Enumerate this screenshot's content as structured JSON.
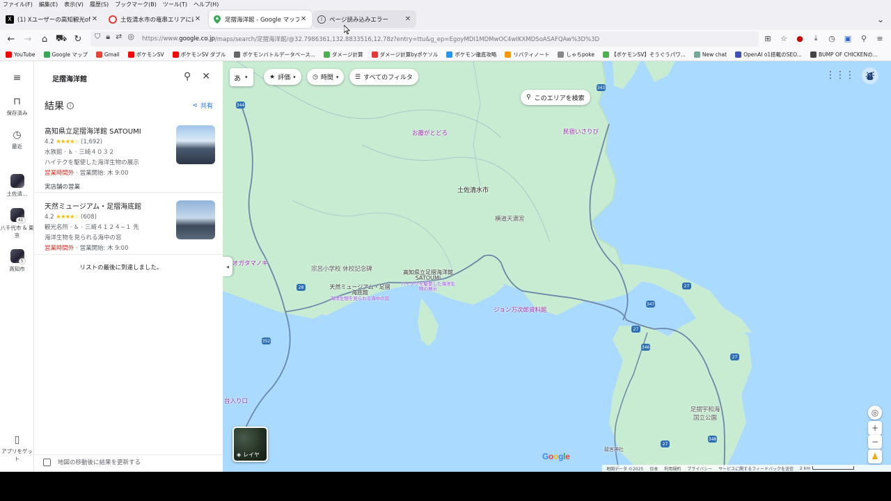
{
  "menubar": [
    "ファイル(F)",
    "編集(E)",
    "表示(V)",
    "履歴(S)",
    "ブックマーク(B)",
    "ツール(T)",
    "ヘルプ(H)"
  ],
  "tabs": [
    {
      "title": "(1) Xユーザーの高知観光officialさん",
      "icon": "x-logo-icon",
      "color": "#000000"
    },
    {
      "title": "土佐清水市の竜串エリアに遊びに",
      "icon": "pokeball-icon",
      "color": "#e53935"
    },
    {
      "title": "足摺海洋館 - Google マップ",
      "icon": "maps-pin-icon",
      "color": "#34a853"
    },
    {
      "title": "ページ読み込みエラー",
      "icon": "info-icon",
      "color": "#555555"
    }
  ],
  "url": {
    "prefix": "https://www.",
    "domain": "google.co.jp",
    "path": "/maps/search/足摺海洋館/@32.7986361,132.8833516,12.78z?entry=ttu&g_ep=EgoyMDI1MDMwOC4wIKXMDSoASAFQAw%3D%3D"
  },
  "bookmarks": [
    {
      "label": "YouTube",
      "color": "#ff0000"
    },
    {
      "label": "Google マップ",
      "color": "#34a853"
    },
    {
      "label": "Gmail",
      "color": "#ea4335"
    },
    {
      "label": "ポケモンSV",
      "color": "#ff0000"
    },
    {
      "label": "ポケモンSV ダブル",
      "color": "#ff0000"
    },
    {
      "label": "ポケモンバトルデータベース...",
      "color": "#666666"
    },
    {
      "label": "ダメージ計算",
      "color": "#4caf50"
    },
    {
      "label": "ダメージ計算byポケソル",
      "color": "#e53935"
    },
    {
      "label": "ポケモン徹底攻略",
      "color": "#2196f3"
    },
    {
      "label": "リバティノート",
      "color": "#ff9800"
    },
    {
      "label": "しゃちpoke",
      "color": "#888888"
    },
    {
      "label": "【ポケモンSV】そうぐうパワ...",
      "color": "#4caf50"
    },
    {
      "label": "New chat",
      "color": "#74aa9c"
    },
    {
      "label": "OpenAI o1搭載のSEO...",
      "color": "#3f51b5"
    },
    {
      "label": "BUMP OF CHICKENの...",
      "color": "#444444"
    }
  ],
  "rail": {
    "saved": "保存済み",
    "recent": "最近",
    "recent_items": [
      {
        "label": "土佐清...",
        "badge": ""
      },
      {
        "label": "八千代市 & 東京",
        "badge": "41"
      },
      {
        "label": "高知市",
        "badge": "5"
      }
    ],
    "get_app": "アプリをゲット"
  },
  "search": {
    "query": "足摺海洋館"
  },
  "results": {
    "heading": "結果",
    "share": "共有",
    "places": [
      {
        "name": "高知県立足摺海洋館 SATOUMI",
        "rating": "4.2",
        "stars": "★★★★☆",
        "reviews": "(1,692)",
        "category_line": "水族館 · ♿ · 三崎４０３２",
        "desc": "ハイテクを駆使した海洋生物の展示",
        "status": "営業時間外",
        "hours": " · 営業開始: 木 9:00",
        "extra": "実店舗の営業"
      },
      {
        "name": "天然ミュージアム・足摺海底館",
        "rating": "4.2",
        "stars": "★★★★☆",
        "reviews": "(608)",
        "category_line": "観光名所 · ♿ · 三崎４１２４−１ 先",
        "desc": "海洋生物を見られる海中の窓",
        "status": "営業時間外",
        "hours": " · 営業開始: 木 9:00",
        "extra": ""
      }
    ],
    "end_note": "リストの最後に到達しました。",
    "refresh": "地図の移動後に結果を更新する"
  },
  "map": {
    "lang": "あ",
    "chips": {
      "rating": "評価",
      "time": "時間",
      "filters": "すべてのフィルタ"
    },
    "search_area": "このエリアを検索",
    "labels": {
      "ofuji": "お藤がとどろ",
      "minshuku": "民宿いさりび",
      "tosashimizu": "土佐清水市",
      "yokomichi": "横道天満宮",
      "ogatamanoki": "オガタマノキ",
      "school": "宗呂小学校 休校記念碑",
      "museum_name": "天然ミュージアム・足摺海底館",
      "museum_sub": "海洋生物を見られる海中の窓",
      "satoumi_name": "高知県立足摺海洋館 SATOUMI",
      "satoumi_sub": "ハイテクを駆使した海洋生物の展示",
      "john": "ジョン万次郎資料館",
      "iriguchi": "台入り口",
      "park": "足摺宇和海国立公園",
      "shrine": "龍宮神社"
    },
    "route_shields": [
      "343",
      "344",
      "28",
      "352",
      "27",
      "347",
      "27",
      "346",
      "27",
      "348",
      "27"
    ],
    "layers": "レイヤ",
    "google": "Google",
    "attribution": [
      "地図データ ©2025",
      "日本",
      "利用規約",
      "プライバシー",
      "サービスに関するフィードバックを送信",
      "2 km"
    ]
  },
  "colors": {
    "accent": "#1a73e8",
    "closed": "#d93025",
    "water": "#aadaff",
    "land": "#c8ecd2"
  }
}
